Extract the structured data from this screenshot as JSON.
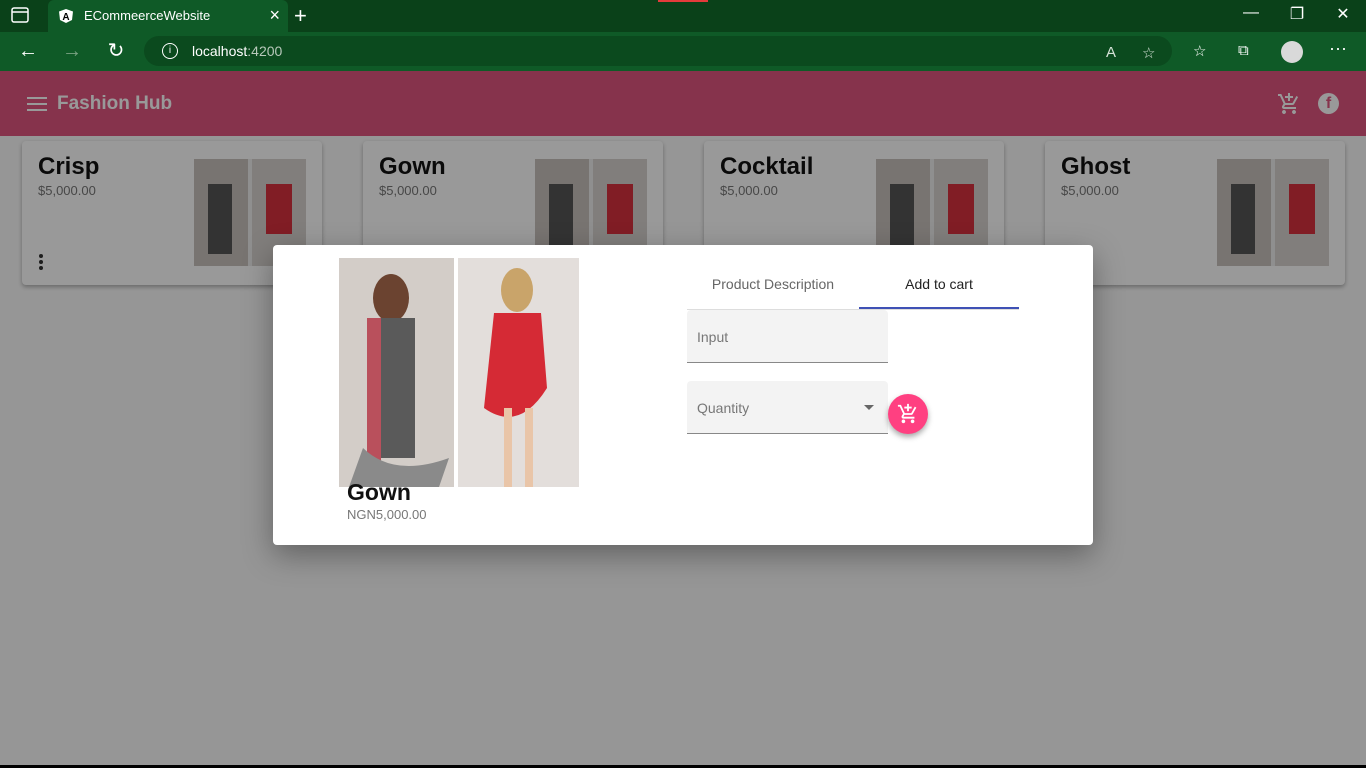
{
  "browser": {
    "tab_title": "ECommeerceWebsite",
    "url_host": "localhost",
    "url_port": ":4200"
  },
  "app": {
    "brand": "Fashion Hub"
  },
  "products": [
    {
      "name": "Crisp",
      "price": "$5,000.00"
    },
    {
      "name": "Gown",
      "price": "$5,000.00"
    },
    {
      "name": "Cocktail",
      "price": "$5,000.00"
    },
    {
      "name": "Ghost",
      "price": "$5,000.00"
    }
  ],
  "dialog": {
    "product_name": "Gown",
    "product_price": "NGN5,000.00",
    "tabs": [
      "Product Description",
      "Add to cart"
    ],
    "active_tab": "Add to cart",
    "input_placeholder": "Input",
    "quantity_label": "Quantity"
  },
  "colors": {
    "header": "#e0557f",
    "fab": "#ff4081",
    "tab_indicator": "#3f51b5",
    "browser_chrome": "#0f5a27"
  }
}
